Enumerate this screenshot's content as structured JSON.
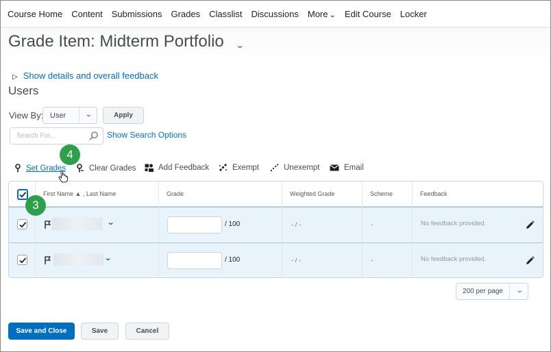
{
  "nav": {
    "items": [
      "Course Home",
      "Content",
      "Submissions",
      "Grades",
      "Classlist",
      "Discussions",
      "More",
      "Edit Course",
      "Locker"
    ]
  },
  "page": {
    "title": "Grade Item: Midterm Portfolio",
    "show_details_link": "Show details and overall feedback",
    "users_heading": "Users"
  },
  "filters": {
    "view_by_label": "View By:",
    "view_by_value": "User",
    "apply_label": "Apply",
    "search_placeholder": "Search For...",
    "search_options_link": "Show Search Options"
  },
  "toolbar": {
    "set_grades": "Set Grades",
    "clear_grades": "Clear Grades",
    "add_feedback": "Add Feedback",
    "exempt": "Exempt",
    "unexempt": "Unexempt",
    "email": "Email"
  },
  "callouts": {
    "step_a": "4",
    "step_b": "3"
  },
  "grid": {
    "headers": {
      "name": "First Name ▲ , Last Name",
      "grade": "Grade",
      "weighted": "Weighted Grade",
      "scheme": "Scheme",
      "feedback": "Feedback"
    },
    "rows": [
      {
        "grade_value": "",
        "grade_max": "/ 100",
        "weighted": "- / -",
        "scheme": "-",
        "feedback": "No feedback provided."
      },
      {
        "grade_value": "",
        "grade_max": "/ 100",
        "weighted": "- / -",
        "scheme": "-",
        "feedback": "No feedback provided."
      }
    ]
  },
  "pagination": {
    "per_page": "200 per page"
  },
  "footer": {
    "save_close": "Save and Close",
    "save": "Save",
    "cancel": "Cancel"
  },
  "colors": {
    "link": "#006fbf",
    "primary": "#006fbf",
    "badge": "#2e9f4c",
    "row_selected": "#e9f3fb"
  },
  "icons": [
    "chevron-down-icon",
    "triangle-right-icon",
    "search-icon",
    "pin-icon",
    "pin-off-icon",
    "feedback-icon",
    "exempt-icon",
    "unexempt-icon",
    "email-icon",
    "flag-icon",
    "checkmark-icon",
    "pencil-icon",
    "hand-cursor-icon"
  ]
}
